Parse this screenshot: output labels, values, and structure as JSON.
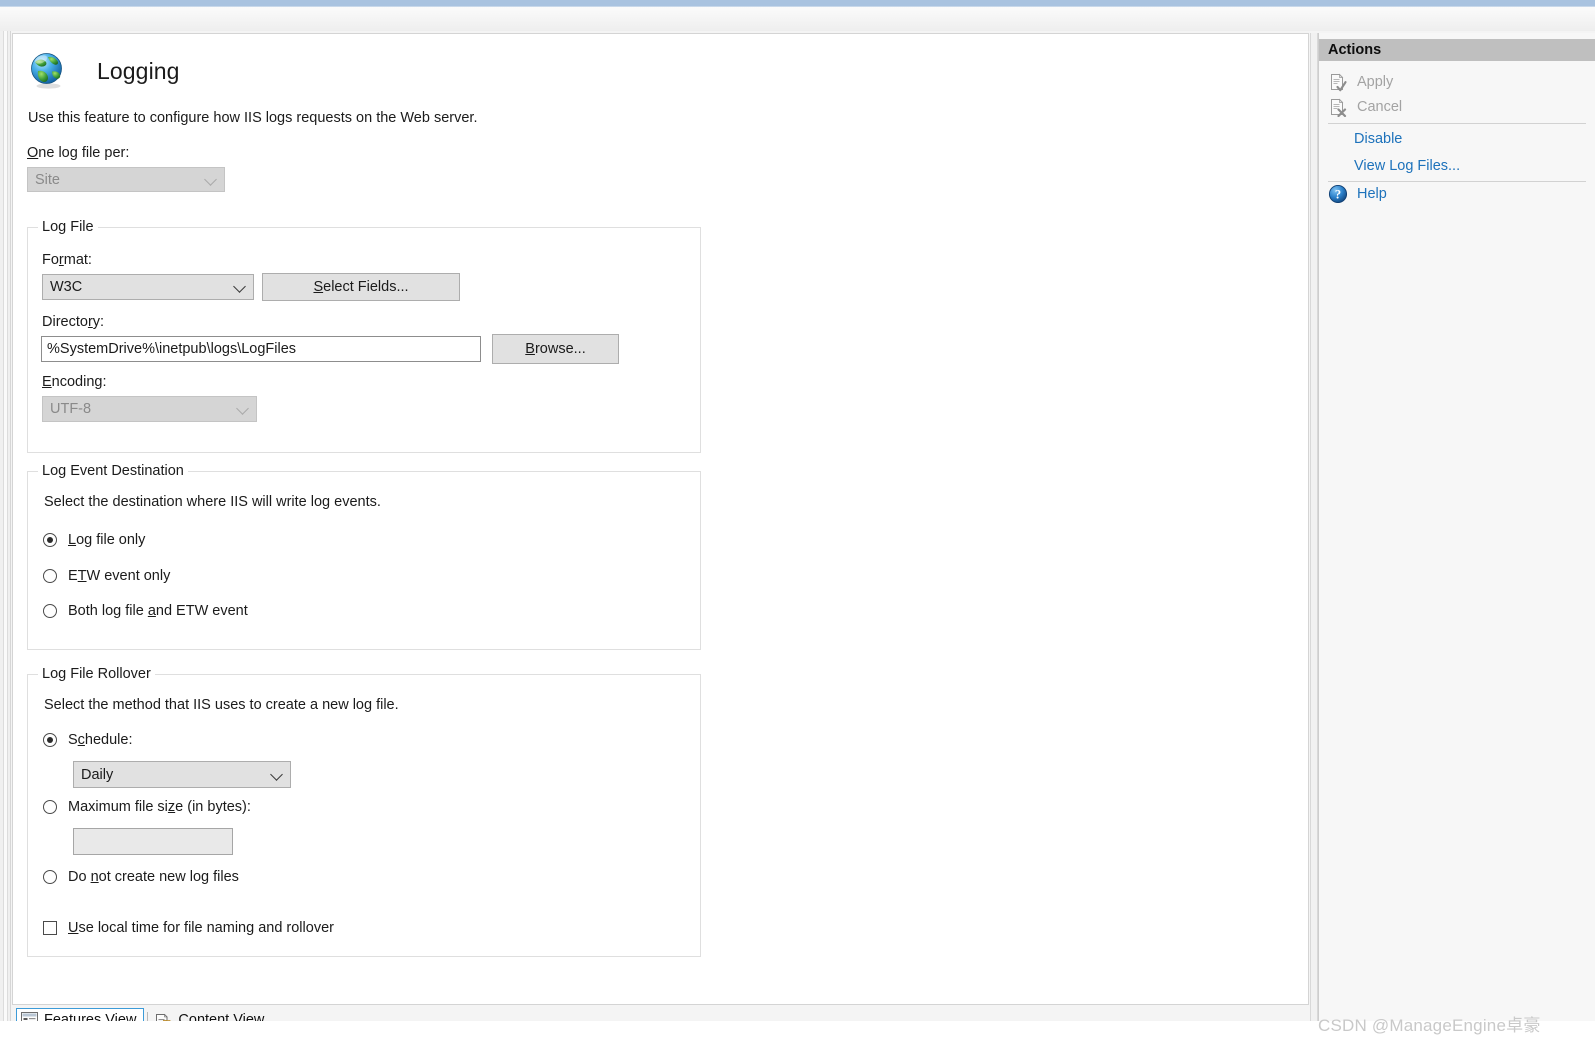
{
  "page": {
    "title": "Logging",
    "description": "Use this feature to configure how IIS logs requests on the Web server.",
    "icon": "globe-icon"
  },
  "one_log_file_per": {
    "label": "One log file per:",
    "value": "Site",
    "enabled": false
  },
  "log_file_group": {
    "title": "Log File",
    "format": {
      "label": "Format:",
      "value": "W3C",
      "enabled": true
    },
    "select_fields_button": "Select Fields...",
    "directory": {
      "label": "Directory:",
      "value": "%SystemDrive%\\inetpub\\logs\\LogFiles",
      "enabled": true
    },
    "browse_button": "Browse...",
    "encoding": {
      "label": "Encoding:",
      "value": "UTF-8",
      "enabled": false
    }
  },
  "log_event_destination_group": {
    "title": "Log Event Destination",
    "description": "Select the destination where IIS will write log events.",
    "options": [
      {
        "label": "Log file only",
        "selected": true
      },
      {
        "label": "ETW event only",
        "selected": false
      },
      {
        "label": "Both log file and ETW event",
        "selected": false
      }
    ]
  },
  "log_file_rollover_group": {
    "title": "Log File Rollover",
    "description": "Select the method that IIS uses to create a new log file.",
    "options": [
      {
        "label": "Schedule:",
        "selected": true
      },
      {
        "label": "Maximum file size (in bytes):",
        "selected": false
      },
      {
        "label": "Do not create new log files",
        "selected": false
      }
    ],
    "schedule": {
      "value": "Daily",
      "enabled": true
    },
    "max_file_size": {
      "value": "",
      "enabled": false
    },
    "use_local_time": {
      "label": "Use local time for file naming and rollover",
      "checked": false
    }
  },
  "view_tabs": [
    {
      "label": "Features View",
      "icon": "features-view-icon",
      "active": true
    },
    {
      "label": "Content View",
      "icon": "content-view-icon",
      "active": false
    }
  ],
  "actions_panel": {
    "header": "Actions",
    "items": [
      {
        "label": "Apply",
        "icon": "apply-document-check-icon",
        "state": "disabled"
      },
      {
        "label": "Cancel",
        "icon": "cancel-document-x-icon",
        "state": "disabled"
      },
      {
        "label": "Disable",
        "icon": "",
        "state": "link"
      },
      {
        "label": "View Log Files...",
        "icon": "",
        "state": "link"
      },
      {
        "label": "Help",
        "icon": "help-circle-icon",
        "state": "link"
      }
    ]
  },
  "watermark": "CSDN @ManageEngine卓豪",
  "colors": {
    "link": "#1d72bb",
    "disabled_text": "#a3a3a3",
    "actions_header_bg": "#bfbfbf",
    "top_bar": "#a9c3e0",
    "active_tab_border": "#3c9bd8"
  }
}
